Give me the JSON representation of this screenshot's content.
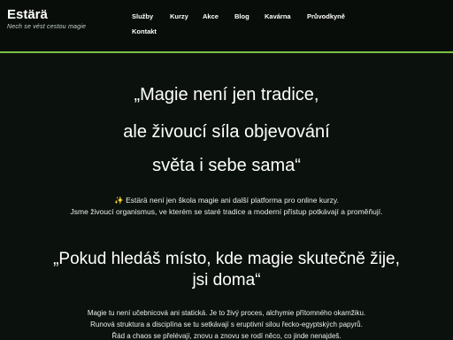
{
  "header": {
    "brand": "Estärä",
    "tagline": "Nech se vést cestou magie"
  },
  "nav": {
    "items": [
      "Služby",
      "Kurzy",
      "Akce",
      "Blog",
      "Kavárna",
      "Průvodkyně",
      "Kontakt"
    ]
  },
  "colors": {
    "background": "#0b120d",
    "accent": "#7bc043",
    "text": "#ffffff"
  },
  "hero": {
    "line1": "„Magie není jen tradice,",
    "line2": "ale živoucí síla objevování",
    "line3": "světa i sebe sama“"
  },
  "intro": {
    "icon": "sparkles-icon",
    "icon_glyph": "✨",
    "line1": "Estärä není jen škola magie ani další platforma pro online kurzy.",
    "line2": "Jsme živoucí organismus, ve kterém se staré tradice a moderní přístup potkávají a proměňují."
  },
  "section": {
    "title_line1": "„Pokud hledáš místo, kde magie skutečně žije,",
    "title_line2": "jsi doma“",
    "para_line1": "Magie tu není učebnicová ani statická. Je to živý proces, alchymie přítomného okamžiku.",
    "para_line2": "Runová struktura a disciplína se tu setkávají s eruptivní silou řecko-egyptských papyrů.",
    "para_line3": "Řád a chaos se přelévají, znovu a znovu se rodí něco, co jinde nenajdeš."
  }
}
